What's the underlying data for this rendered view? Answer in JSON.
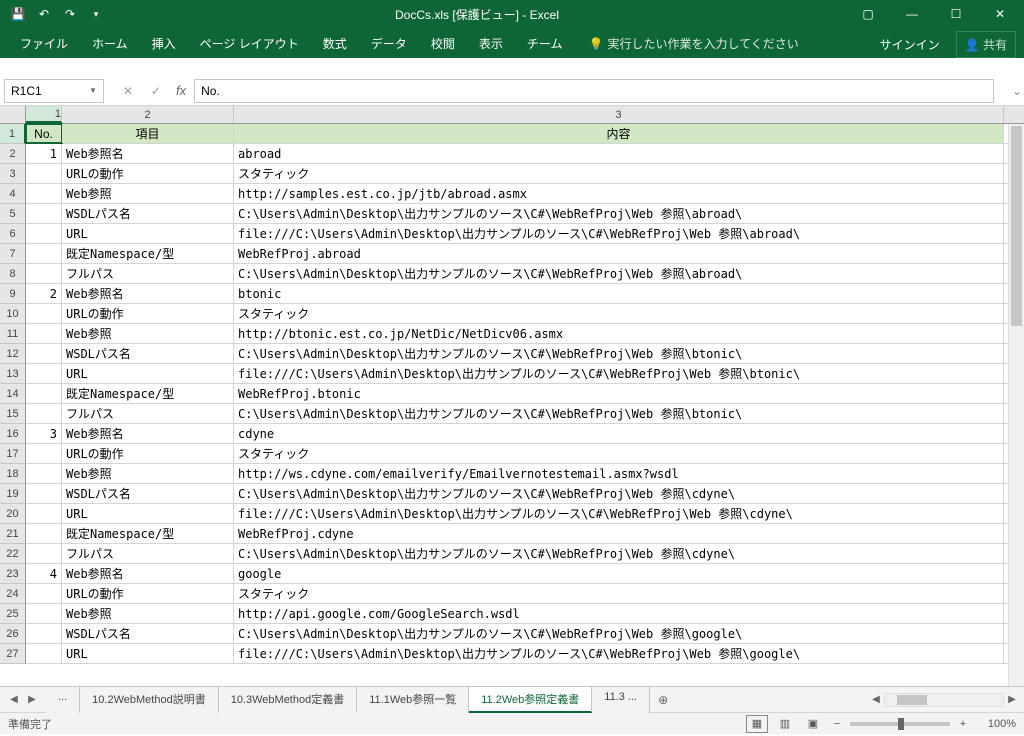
{
  "title": "DocCs.xls [保護ビュー] - Excel",
  "qat": {
    "save": "💾",
    "undo": "↶",
    "redo": "↷",
    "dd": "▾"
  },
  "winbtns": {
    "rib": "▢",
    "min": "—",
    "max": "☐",
    "close": "✕"
  },
  "tabs": [
    "ファイル",
    "ホーム",
    "挿入",
    "ページ レイアウト",
    "数式",
    "データ",
    "校閲",
    "表示",
    "チーム"
  ],
  "tell": "実行したい作業を入力してください",
  "signin": "サインイン",
  "share": "共有",
  "namebox": "R1C1",
  "fx": "fx",
  "formula": "No.",
  "colHeaders": [
    "1",
    "2",
    "3"
  ],
  "rowHeaders": [
    "1",
    "2",
    "3",
    "4",
    "5",
    "6",
    "7",
    "8",
    "9",
    "10",
    "11",
    "12",
    "13",
    "14",
    "15",
    "16",
    "17",
    "18",
    "19",
    "20",
    "21",
    "22",
    "23",
    "24",
    "25",
    "26",
    "27"
  ],
  "headerRow": [
    "No.",
    "項目",
    "内容"
  ],
  "rows": [
    [
      "1",
      "Web参照名",
      "abroad"
    ],
    [
      "",
      "URLの動作",
      "スタティック"
    ],
    [
      "",
      "Web参照",
      "http://samples.est.co.jp/jtb/abroad.asmx"
    ],
    [
      "",
      "WSDLパス名",
      "C:\\Users\\Admin\\Desktop\\出力サンプルのソース\\C#\\WebRefProj\\Web 参照\\abroad\\"
    ],
    [
      "",
      "URL",
      "file:///C:\\Users\\Admin\\Desktop\\出力サンプルのソース\\C#\\WebRefProj\\Web 参照\\abroad\\"
    ],
    [
      "",
      "既定Namespace/型",
      "WebRefProj.abroad"
    ],
    [
      "",
      "フルパス",
      "C:\\Users\\Admin\\Desktop\\出力サンプルのソース\\C#\\WebRefProj\\Web 参照\\abroad\\"
    ],
    [
      "2",
      "Web参照名",
      "btonic"
    ],
    [
      "",
      "URLの動作",
      "スタティック"
    ],
    [
      "",
      "Web参照",
      "http://btonic.est.co.jp/NetDic/NetDicv06.asmx"
    ],
    [
      "",
      "WSDLパス名",
      "C:\\Users\\Admin\\Desktop\\出力サンプルのソース\\C#\\WebRefProj\\Web 参照\\btonic\\"
    ],
    [
      "",
      "URL",
      "file:///C:\\Users\\Admin\\Desktop\\出力サンプルのソース\\C#\\WebRefProj\\Web 参照\\btonic\\"
    ],
    [
      "",
      "既定Namespace/型",
      "WebRefProj.btonic"
    ],
    [
      "",
      "フルパス",
      "C:\\Users\\Admin\\Desktop\\出力サンプルのソース\\C#\\WebRefProj\\Web 参照\\btonic\\"
    ],
    [
      "3",
      "Web参照名",
      "cdyne"
    ],
    [
      "",
      "URLの動作",
      "スタティック"
    ],
    [
      "",
      "Web参照",
      "http://ws.cdyne.com/emailverify/Emailvernotestemail.asmx?wsdl"
    ],
    [
      "",
      "WSDLパス名",
      "C:\\Users\\Admin\\Desktop\\出力サンプルのソース\\C#\\WebRefProj\\Web 参照\\cdyne\\"
    ],
    [
      "",
      "URL",
      "file:///C:\\Users\\Admin\\Desktop\\出力サンプルのソース\\C#\\WebRefProj\\Web 参照\\cdyne\\"
    ],
    [
      "",
      "既定Namespace/型",
      "WebRefProj.cdyne"
    ],
    [
      "",
      "フルパス",
      "C:\\Users\\Admin\\Desktop\\出力サンプルのソース\\C#\\WebRefProj\\Web 参照\\cdyne\\"
    ],
    [
      "4",
      "Web参照名",
      "google"
    ],
    [
      "",
      "URLの動作",
      "スタティック"
    ],
    [
      "",
      "Web参照",
      "http://api.google.com/GoogleSearch.wsdl"
    ],
    [
      "",
      "WSDLパス名",
      "C:\\Users\\Admin\\Desktop\\出力サンプルのソース\\C#\\WebRefProj\\Web 参照\\google\\"
    ],
    [
      "",
      "URL",
      "file:///C:\\Users\\Admin\\Desktop\\出力サンプルのソース\\C#\\WebRefProj\\Web 参照\\google\\"
    ]
  ],
  "sheets": {
    "nav": {
      "first": "…",
      "prev": "◀",
      "next": "▶"
    },
    "tabs": [
      {
        "label": "...",
        "active": false
      },
      {
        "label": "10.2WebMethod説明書",
        "active": false
      },
      {
        "label": "10.3WebMethod定義書",
        "active": false
      },
      {
        "label": "11.1Web参照一覧",
        "active": false
      },
      {
        "label": "11.2Web参照定義書",
        "active": true
      },
      {
        "label": "11.3 ...",
        "active": false
      }
    ],
    "add": "⊕"
  },
  "status": {
    "ready": "準備完了",
    "zoom": "100%",
    "minus": "−",
    "plus": "+"
  }
}
